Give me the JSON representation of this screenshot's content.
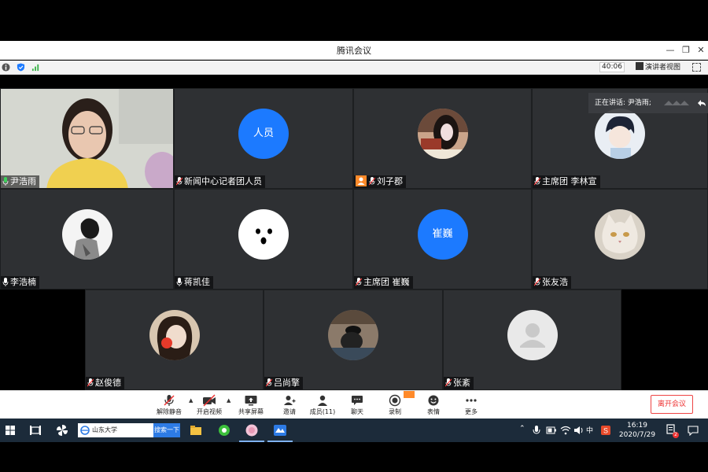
{
  "window": {
    "title": "腾讯会议",
    "timer": "40:06",
    "speaker_view_label": "演讲者视图",
    "speaking_prefix": "正在讲话: 尹浩雨;"
  },
  "participants": [
    {
      "name": "尹浩雨",
      "avatar_text": ""
    },
    {
      "name": "新闻中心记者团人员",
      "avatar_text": "人员"
    },
    {
      "name": "刘子郡",
      "avatar_text": ""
    },
    {
      "name": "主席团 李林宣",
      "avatar_text": ""
    },
    {
      "name": "李浩楠",
      "avatar_text": ""
    },
    {
      "name": "蒋凯佳",
      "avatar_text": ""
    },
    {
      "name": "主席团 崔巍",
      "avatar_text": "崔巍"
    },
    {
      "name": "张友浩",
      "avatar_text": ""
    },
    {
      "name": "赵俊德",
      "avatar_text": ""
    },
    {
      "name": "吕尚擎",
      "avatar_text": ""
    },
    {
      "name": "张紊",
      "avatar_text": ""
    }
  ],
  "toolbar": {
    "mute": "解除静音",
    "video": "开启视频",
    "share": "共享屏幕",
    "invite": "邀请",
    "members": "成员(11)",
    "chat": "聊天",
    "record": "录制",
    "emoji": "表情",
    "more": "更多",
    "leave": "离开会议"
  },
  "taskbar": {
    "search_text": "山东大学",
    "search_button": "搜索一下",
    "ime": "中",
    "time": "16:19",
    "date": "2020/7/29",
    "notification_count": "2"
  },
  "colors": {
    "accent_blue": "#1c7aff",
    "host_orange": "#ff8a2a",
    "leave_red": "#e33333",
    "tile_bg": "#2e3033"
  }
}
